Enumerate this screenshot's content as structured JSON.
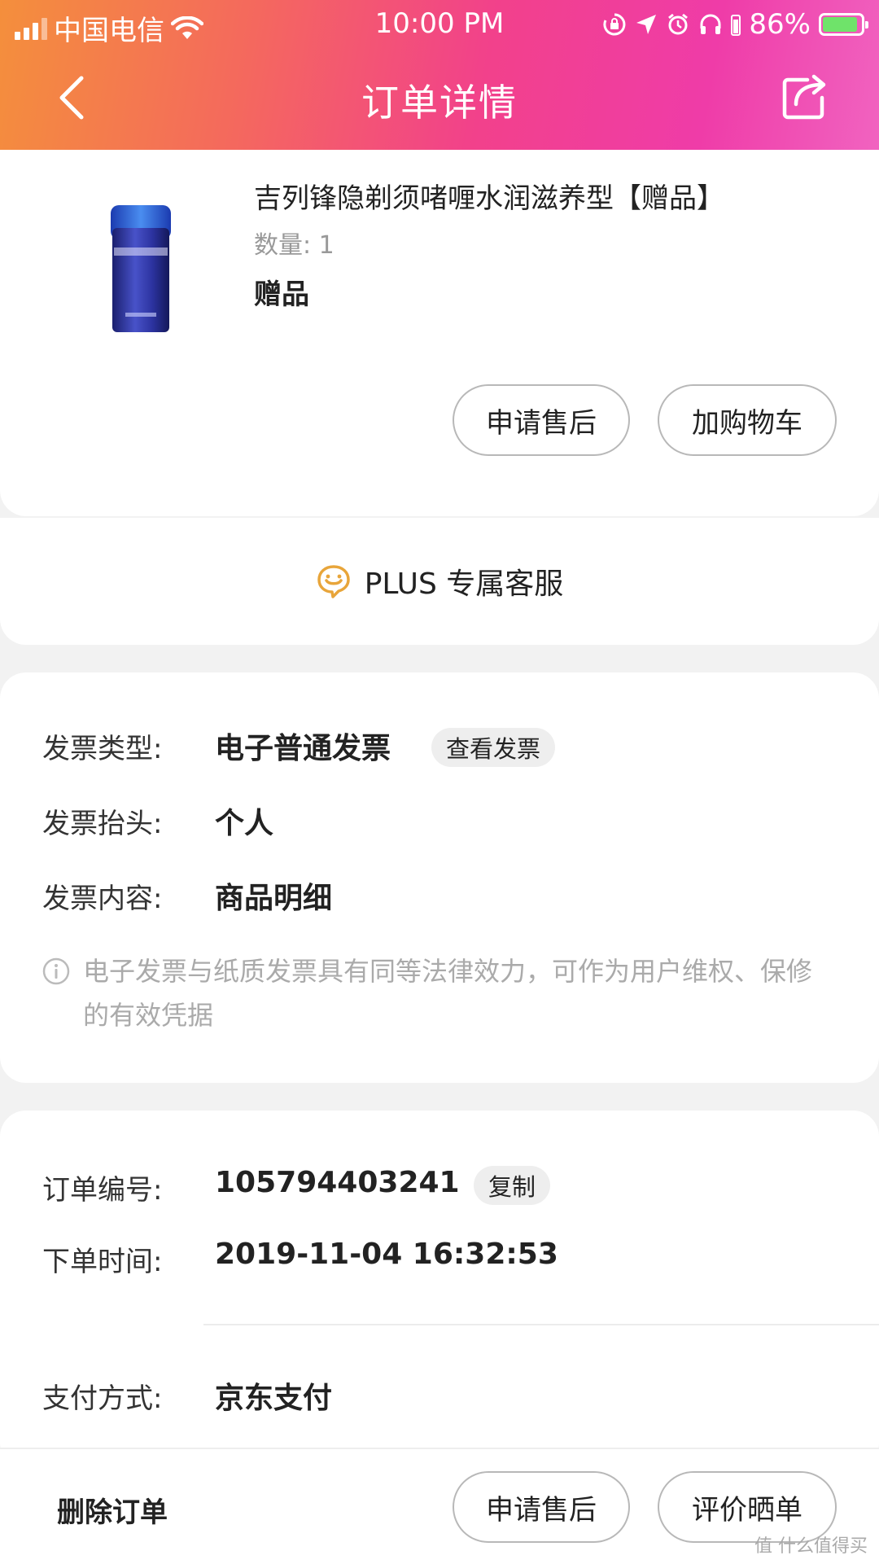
{
  "status_bar": {
    "carrier": "中国电信",
    "time": "10:00 PM",
    "battery": "86%",
    "battery_level": 0.86
  },
  "nav": {
    "title": "订单详情",
    "back_icon": "chevron-left-icon",
    "share_icon": "share-icon"
  },
  "product": {
    "name": "吉列锋隐剃须啫喱水润滋养型【赠品】",
    "quantity": "数量: 1",
    "tag": "赠品",
    "actions": {
      "after_sale": "申请售后",
      "add_to_cart": "加购物车"
    }
  },
  "service": {
    "label": "PLUS 专属客服",
    "icon": "chat-bubble-icon"
  },
  "invoice": {
    "type_label": "发票类型:",
    "type_value": "电子普通发票",
    "view_button": "查看发票",
    "title_label": "发票抬头:",
    "title_value": "个人",
    "content_label": "发票内容:",
    "content_value": "商品明细",
    "note": "电子发票与纸质发票具有同等法律效力，可作为用户维权、保修的有效凭据"
  },
  "order": {
    "number_label": "订单编号:",
    "number_value": "105794403241",
    "copy_button": "复制",
    "time_label": "下单时间:",
    "time_value": "2019-11-04 16:32:53",
    "payment_label": "支付方式:",
    "payment_value": "京东支付"
  },
  "bottom_bar": {
    "delete": "删除订单",
    "after_sale": "申请售后",
    "review": "评价晒单"
  },
  "watermark": "值 什么值得买",
  "colors": {
    "header_start": "#f48f3c",
    "header_end": "#ef3ca8",
    "service_icon": "#e8a53a",
    "battery_fill": "#6fe36a"
  }
}
